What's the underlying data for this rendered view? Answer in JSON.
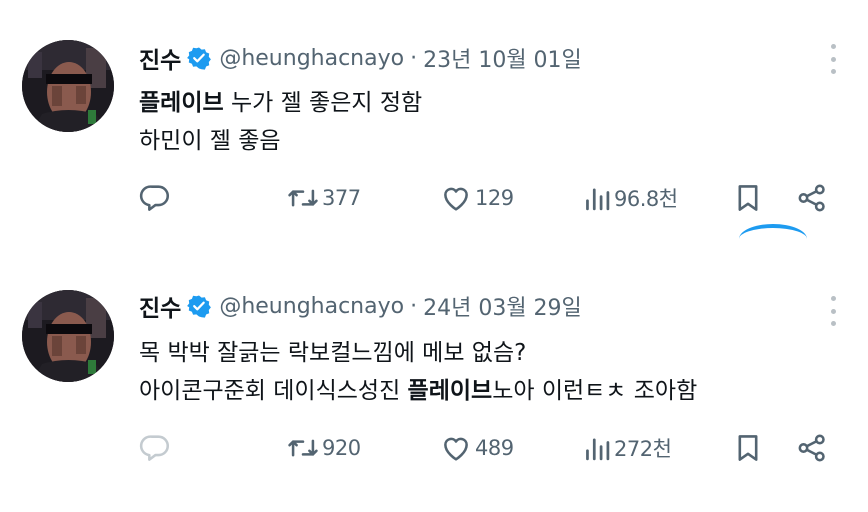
{
  "tweets": [
    {
      "name": "진수",
      "handle": "@heunghacnayo",
      "separator": "·",
      "date": "23년 10월 01일",
      "line1_bold": "플레이브",
      "line1_rest": " 누가 젤 좋은지 정함",
      "line2": "하민이 젤 좋음",
      "retweets": "377",
      "likes": "129",
      "views": "96.8천"
    },
    {
      "name": "진수",
      "handle": "@heunghacnayo",
      "separator": "·",
      "date": "24년 03월 29일",
      "line1": "목 박박 잘긁는 락보컬느낌에 메보 없슴?",
      "line2_pre": "아이콘구준회 데이식스성진 ",
      "line2_bold": "플레이브",
      "line2_post": "노아 이런ㅌㅊ 조아함",
      "retweets": "920",
      "likes": "489",
      "views": "272천"
    }
  ],
  "icons": {
    "avatar": "dark-avatar-with-sunglasses",
    "verified": "verified-badge-icon",
    "more": "more-vertical-icon",
    "reply": "reply-icon",
    "retweet": "retweet-icon",
    "like": "heart-icon",
    "views": "views-icon",
    "bookmark": "bookmark-icon",
    "share": "share-icon"
  },
  "colors": {
    "text": "#0f1419",
    "muted": "#536471",
    "verified": "#1d9bf0",
    "accent": "#1d9bf0"
  }
}
